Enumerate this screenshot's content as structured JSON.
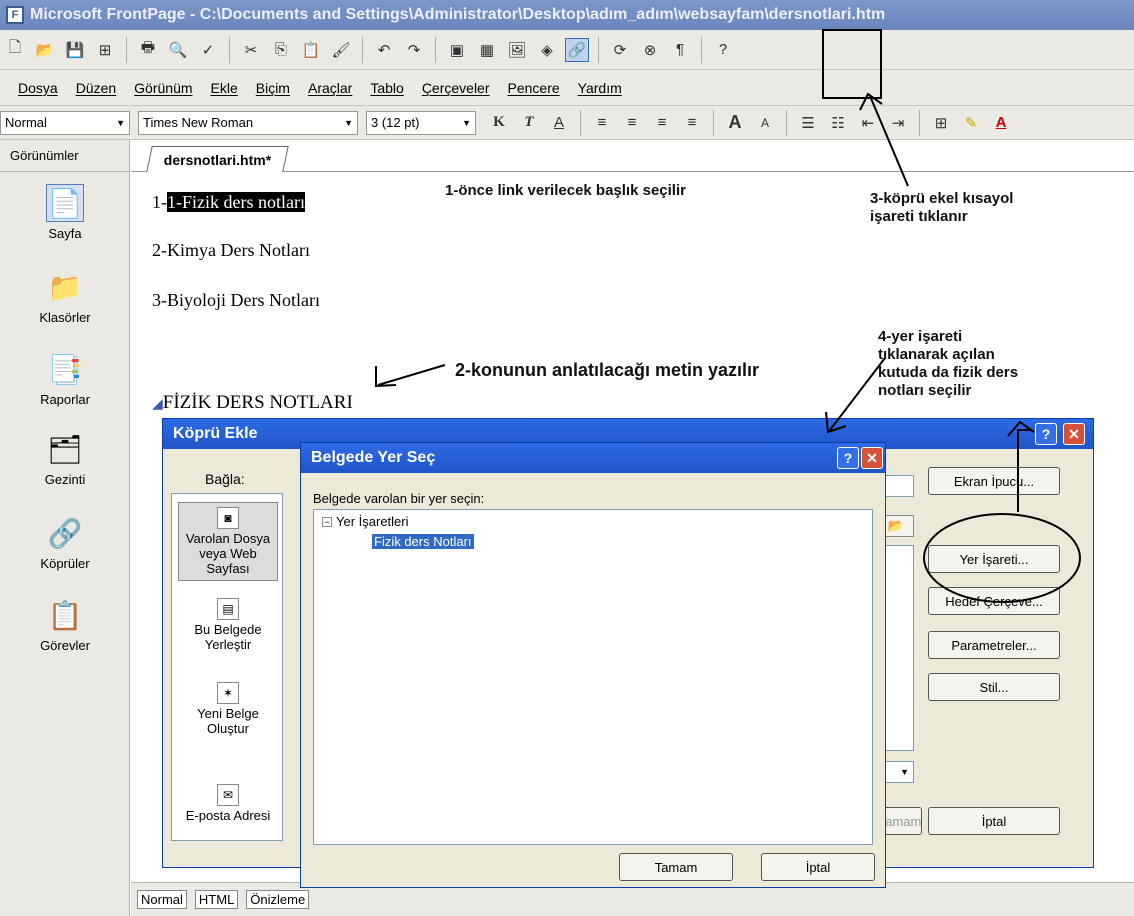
{
  "window": {
    "title": "Microsoft FrontPage - C:\\Documents and Settings\\Administrator\\Desktop\\adım_adım\\websayfam\\dersnotlari.htm"
  },
  "menu": [
    "Dosya",
    "Düzen",
    "Görünüm",
    "Ekle",
    "Biçim",
    "Araçlar",
    "Tablo",
    "Çerçeveler",
    "Pencere",
    "Yardım"
  ],
  "format_bar": {
    "style": "Normal",
    "font": "Times New Roman",
    "size": "3 (12 pt)",
    "bold": "K",
    "italic": "T",
    "underline": "A"
  },
  "views": {
    "header": "Görünümler",
    "items": [
      "Sayfa",
      "Klasörler",
      "Raporlar",
      "Gezinti",
      "Köprüler",
      "Görevler"
    ]
  },
  "document": {
    "tab": "dersnotlari.htm*",
    "lines": [
      "1-Fizik ders notları",
      "2-Kimya Ders Notları",
      "3-Biyoloji Ders Notları"
    ],
    "heading": "FİZİK DERS NOTLARI"
  },
  "annotations": {
    "a1": "1-önce link verilecek başlık seçilir",
    "a2": "2-konunun anlatılacağı metin yazılır",
    "a3_l1": "3-köprü ekel kısayol",
    "a3_l2": "işareti tıklanır",
    "a4_l1": "4-yer işareti",
    "a4_l2": "tıklanarak açılan",
    "a4_l3": "kutuda da fizik ders",
    "a4_l4": "notları seçilir"
  },
  "kopru_dialog": {
    "title": "Köprü Ekle",
    "link_label": "Bağla:",
    "link_items": [
      "Varolan Dosya veya Web Sayfası",
      "Bu Belgede Yerleştir",
      "Yeni Belge Oluştur",
      "E-posta Adresi"
    ],
    "buttons": {
      "tooltip": "Ekran İpucu...",
      "bookmark": "Yer İşareti...",
      "target": "Hedef Çerçeve...",
      "params": "Parametreler...",
      "style": "Stil...",
      "ok": "Tamam",
      "cancel": "İptal"
    }
  },
  "belge_dialog": {
    "title": "Belgede Yer Seç",
    "prompt": "Belgede varolan bir yer seçin:",
    "tree_root": "Yer İşaretleri",
    "tree_child": "Fizik ders Notları",
    "ok": "Tamam",
    "cancel": "İptal"
  },
  "bottom_tabs": [
    "Normal",
    "HTML",
    "Önizleme"
  ]
}
